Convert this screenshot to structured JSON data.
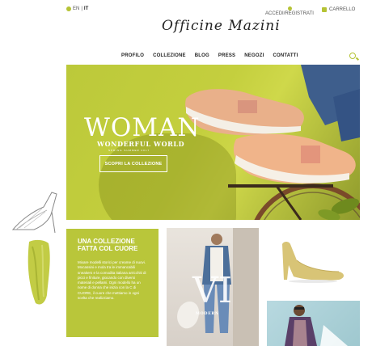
{
  "topbar": {
    "lang_en": "EN",
    "lang_sep": "|",
    "lang_it": "IT",
    "account_label": "ACCEDI/REGISTRATI",
    "cart_label": "CARRELLO"
  },
  "brand": {
    "logo_text": "Officine Mazini"
  },
  "nav": {
    "items": [
      "PROFILO",
      "COLLEZIONE",
      "BLOG",
      "PRESS",
      "NEGOZI",
      "CONTATTI"
    ]
  },
  "hero": {
    "title": "WOMAN",
    "subtitle": "WONDERFUL WORLD",
    "season": "SPRING SUMMER 2017",
    "cta_label": "SCOPRI LA COLLEZIONE"
  },
  "collection": {
    "title": "UNA COLLEZIONE FATTA COL CUORE",
    "body": "Mixare modelli storici per creame di nuovi. Mocassini e mola tra le immancabili sneakers e la comodita italiana arricchiti di picci e finiture, giocando con diversi materiali e pellami. Ogni modello ha un nome di donna che inizia con la C di CUORE, il cuore che mettiamo in ogni scelta che realizziamo."
  },
  "modern_block": {
    "label": "MODERN"
  },
  "colors": {
    "accent": "#b9c63a",
    "hero_bg": "#c4cf3e",
    "text": "#222222"
  }
}
